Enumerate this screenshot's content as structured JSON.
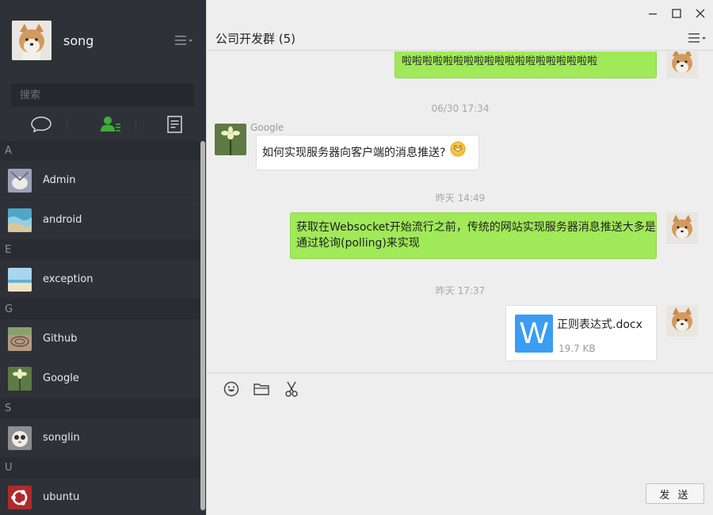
{
  "profile": {
    "name": "song",
    "avatar": "shiba-dog-avatar"
  },
  "search": {
    "placeholder": "搜索"
  },
  "tabs": [
    {
      "name": "chat-tab",
      "icon": "chat-bubble-icon"
    },
    {
      "name": "contacts-tab",
      "icon": "contacts-icon",
      "active": true
    },
    {
      "name": "docs-tab",
      "icon": "document-icon"
    }
  ],
  "contacts": {
    "groups": [
      {
        "letter": "A",
        "items": [
          {
            "name": "Admin"
          },
          {
            "name": "android"
          }
        ]
      },
      {
        "letter": "E",
        "items": [
          {
            "name": "exception"
          }
        ]
      },
      {
        "letter": "G",
        "items": [
          {
            "name": "Github"
          },
          {
            "name": "Google"
          }
        ]
      },
      {
        "letter": "S",
        "items": [
          {
            "name": "songlin"
          }
        ]
      },
      {
        "letter": "U",
        "items": [
          {
            "name": "ubuntu"
          }
        ]
      }
    ]
  },
  "chat": {
    "title": "公司开发群 (5)",
    "messages": [
      {
        "text": "啦啦啦啦啦啦啦啦啦啦啦啦啦啦啦啦啦啦啦"
      },
      {
        "time": "06/30 17:34"
      },
      {
        "sender": "Google",
        "text": "如何实现服务器向客户端的消息推送?"
      },
      {
        "time": "昨天 14:49"
      },
      {
        "text_line1": "获取在Websocket开始流行之前，传统的网站实现服务器消息推送大多是",
        "text_line2": "通过轮询(polling)来实现"
      },
      {
        "time": "昨天 17:37"
      },
      {
        "file_name": "正则表达式.docx",
        "file_size": "19.7 KB",
        "file_letter": "W"
      }
    ]
  },
  "input": {
    "send_label": "发 送"
  },
  "colors": {
    "sidebar": "#2e3238",
    "bubble_green": "#a0e959",
    "accent_green": "#3caf36",
    "file_blue": "#3a9cf3"
  }
}
